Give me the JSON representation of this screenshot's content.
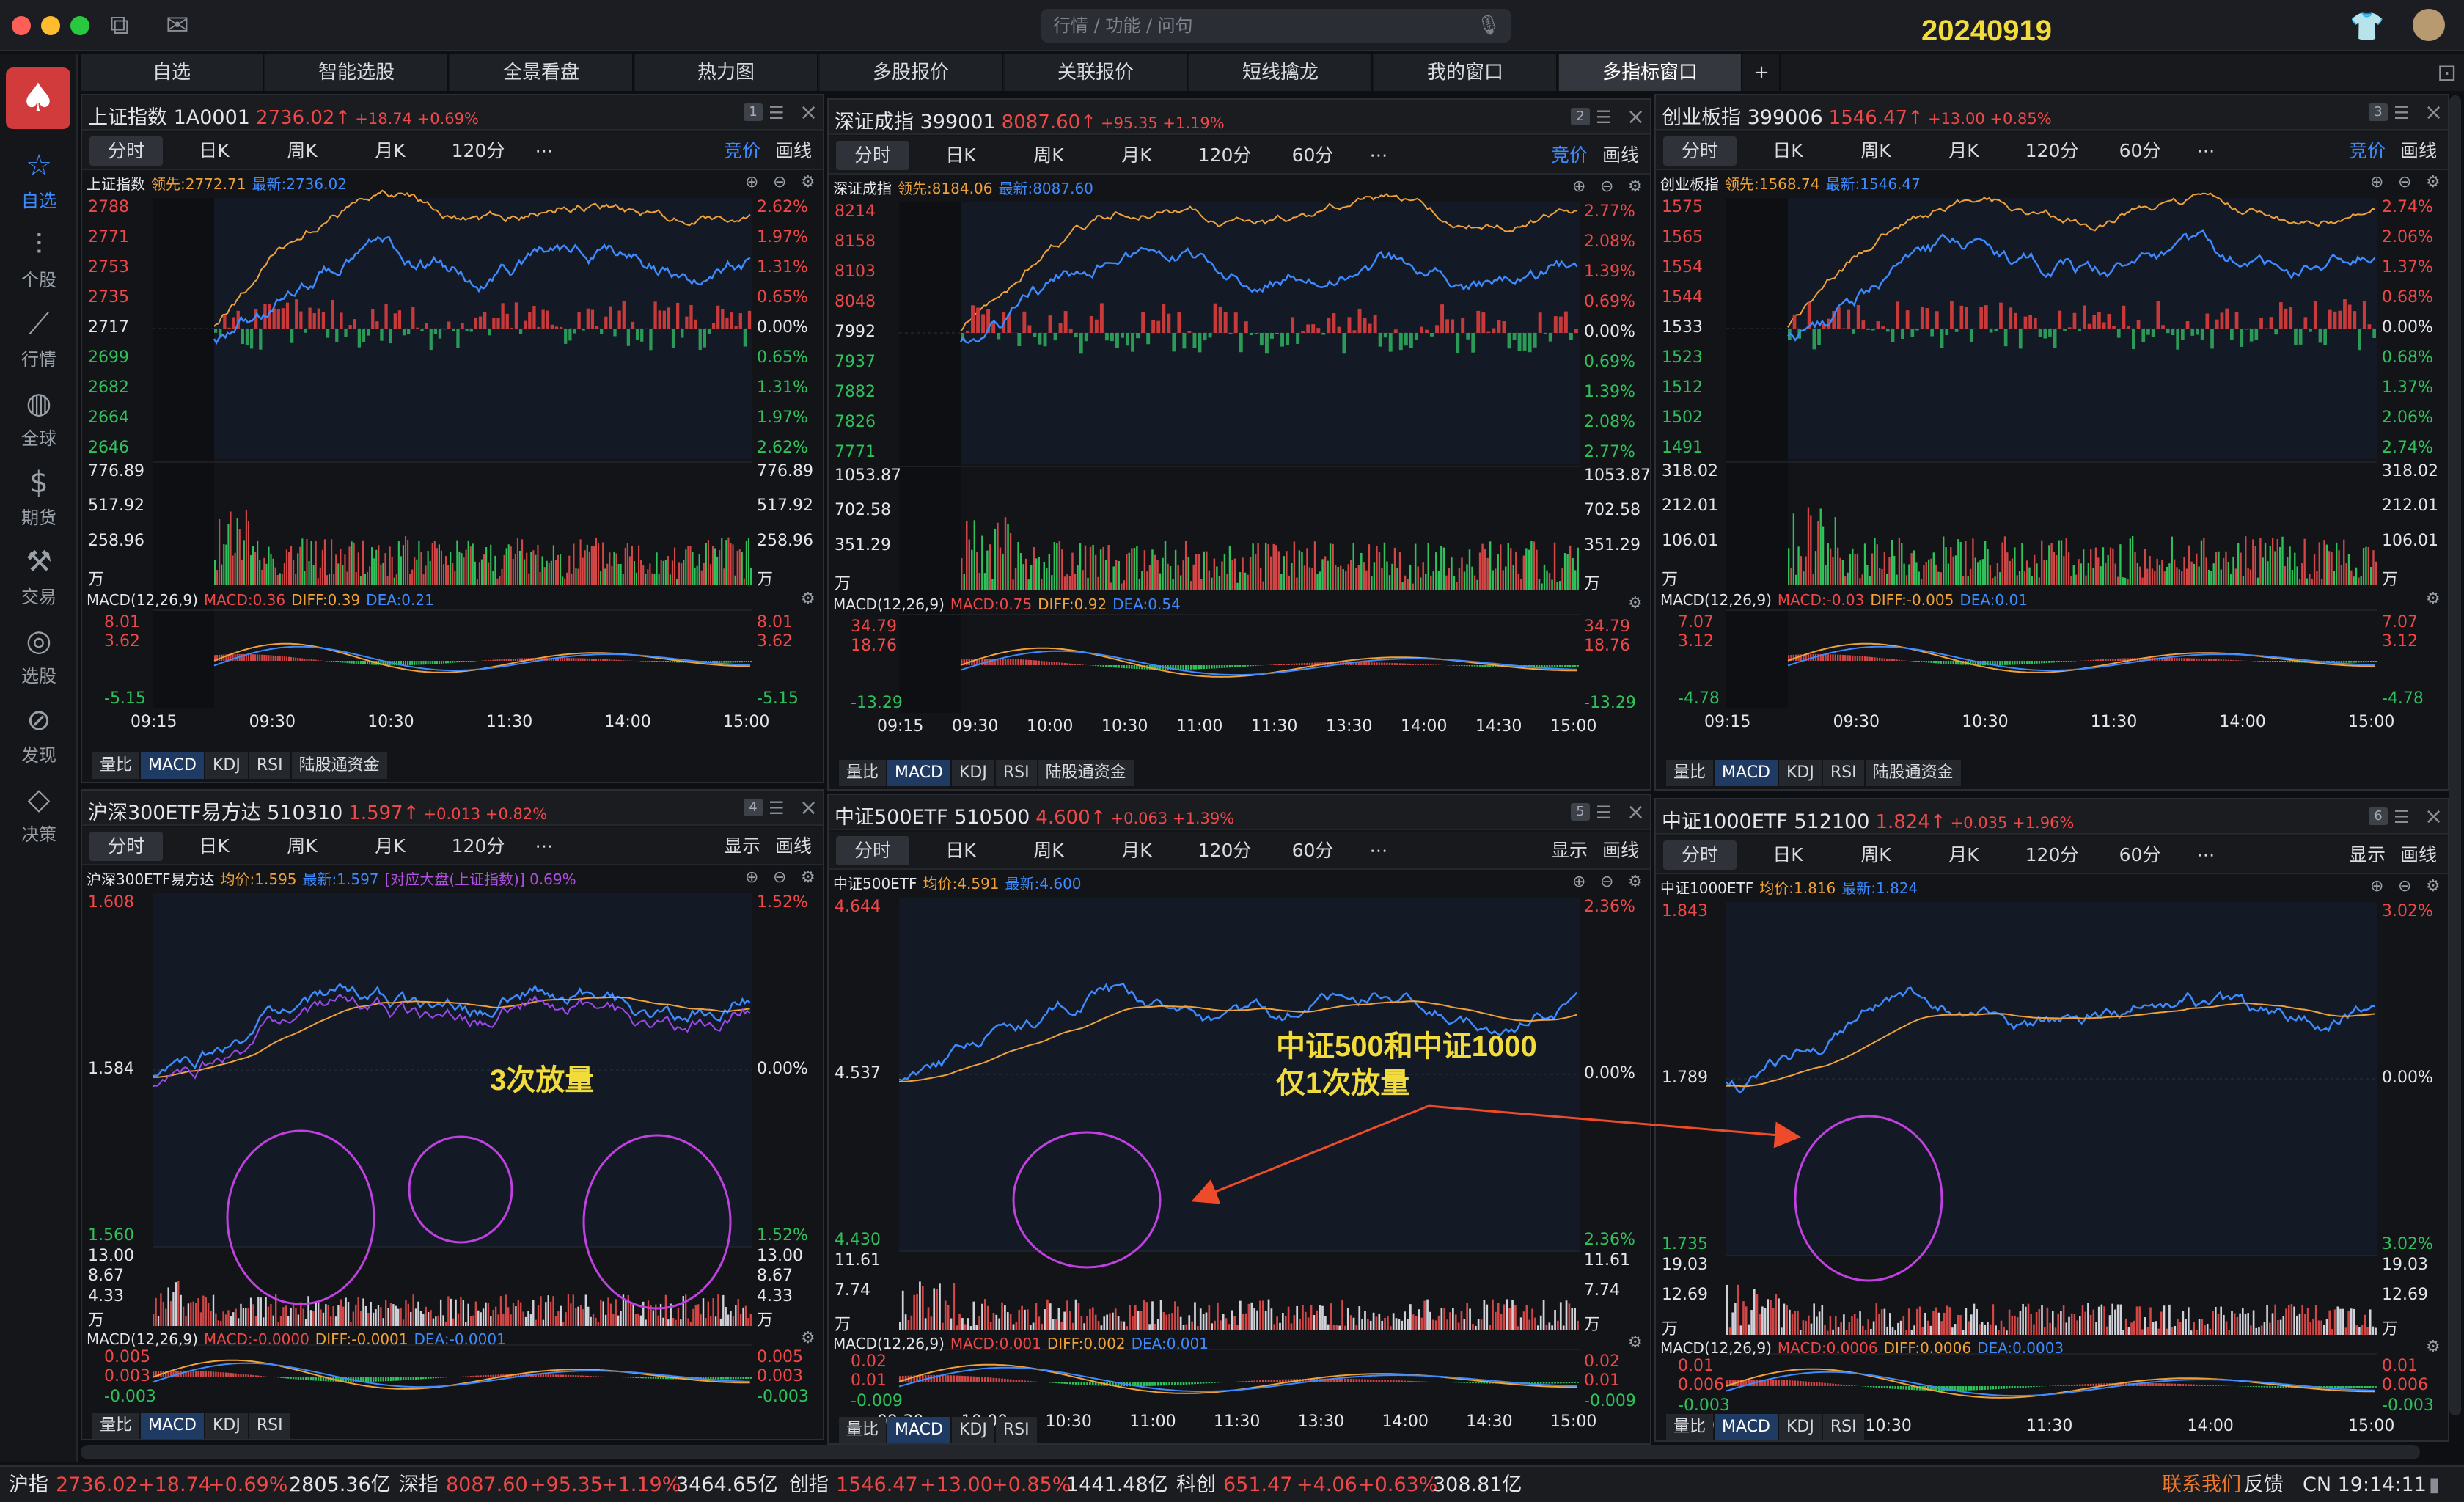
{
  "titlebar": {
    "search_placeholder": "行情 / 功能 / 问句",
    "date_tag": "20240919"
  },
  "tabs": [
    "自选",
    "智能选股",
    "全景看盘",
    "热力图",
    "多股报价",
    "关联报价",
    "短线擒龙",
    "我的窗口",
    "多指标窗口"
  ],
  "active_tab": 8,
  "sidebar": [
    {
      "label": "自选",
      "icon": "star-icon",
      "glyph": "☆"
    },
    {
      "label": "个股",
      "icon": "candlestick-icon",
      "glyph": "⫶"
    },
    {
      "label": "行情",
      "icon": "trend-icon",
      "glyph": "⟋"
    },
    {
      "label": "全球",
      "icon": "globe-icon",
      "glyph": "◍"
    },
    {
      "label": "期货",
      "icon": "futures-icon",
      "glyph": "$"
    },
    {
      "label": "交易",
      "icon": "hammer-icon",
      "glyph": "⚒"
    },
    {
      "label": "选股",
      "icon": "magnifier-icon",
      "glyph": "◎"
    },
    {
      "label": "发现",
      "icon": "compass-icon",
      "glyph": "⊘"
    },
    {
      "label": "决策",
      "icon": "diamond-icon",
      "glyph": "◇"
    }
  ],
  "top_tabs": [
    "分时",
    "日K",
    "周K",
    "月K",
    "120分",
    "60分"
  ],
  "panels": [
    {
      "idx": "1",
      "title": "上证指数 1A0001",
      "price": "2736.02↑",
      "chg": "+18.74 +0.69%",
      "tools": [
        "竞价",
        "画线"
      ],
      "info_name": "上证指数",
      "info_o": "领先:2772.71",
      "info_b": "最新:2736.02",
      "info_p": "",
      "price_left": [
        "2788",
        "2771",
        "2753",
        "2735",
        "2717",
        "2699",
        "2682",
        "2664",
        "2646"
      ],
      "price_right": [
        "2.62%",
        "1.97%",
        "1.31%",
        "0.65%",
        "0.00%",
        "0.65%",
        "1.31%",
        "1.97%",
        "2.62%"
      ],
      "vol_left": [
        "776.89",
        "517.92",
        "258.96",
        "万"
      ],
      "vol_right": [
        "776.89",
        "517.92",
        "258.96",
        "万"
      ],
      "macd_name": "MACD(12,26,9)",
      "macd_v": "MACD:0.36",
      "diff_v": "DIFF:0.39",
      "dea_v": "DEA:0.21",
      "macd_left": [
        "8.01",
        "3.62",
        "-5.15"
      ],
      "macd_right": [
        "8.01",
        "3.62",
        "-5.15"
      ],
      "times": [
        "09:15",
        "09:30",
        "10:30",
        "11:30",
        "14:00",
        "15:00"
      ],
      "btabs": [
        "量比",
        "MACD",
        "KDJ",
        "RSI",
        "陆股通资金"
      ]
    },
    {
      "idx": "2",
      "title": "深证成指 399001",
      "price": "8087.60↑",
      "chg": "+95.35 +1.19%",
      "tools": [
        "竞价",
        "画线"
      ],
      "info_name": "深证成指",
      "info_o": "领先:8184.06",
      "info_b": "最新:8087.60",
      "info_p": "",
      "price_left": [
        "8214",
        "8158",
        "8103",
        "8048",
        "7992",
        "7937",
        "7882",
        "7826",
        "7771"
      ],
      "price_right": [
        "2.77%",
        "2.08%",
        "1.39%",
        "0.69%",
        "0.00%",
        "0.69%",
        "1.39%",
        "2.08%",
        "2.77%"
      ],
      "vol_left": [
        "1053.87",
        "702.58",
        "351.29",
        "万"
      ],
      "vol_right": [
        "1053.87",
        "702.58",
        "351.29",
        "万"
      ],
      "macd_name": "MACD(12,26,9)",
      "macd_v": "MACD:0.75",
      "diff_v": "DIFF:0.92",
      "dea_v": "DEA:0.54",
      "macd_left": [
        "34.79",
        "18.76",
        "-13.29"
      ],
      "macd_right": [
        "34.79",
        "18.76",
        "-13.29"
      ],
      "times": [
        "09:15",
        "09:30",
        "10:00",
        "10:30",
        "11:00",
        "11:30",
        "13:30",
        "14:00",
        "14:30",
        "15:00"
      ],
      "btabs": [
        "量比",
        "MACD",
        "KDJ",
        "RSI",
        "陆股通资金"
      ]
    },
    {
      "idx": "3",
      "title": "创业板指 399006",
      "price": "1546.47↑",
      "chg": "+13.00 +0.85%",
      "tools": [
        "竞价",
        "画线"
      ],
      "info_name": "创业板指",
      "info_o": "领先:1568.74",
      "info_b": "最新:1546.47",
      "info_p": "",
      "price_left": [
        "1575",
        "1565",
        "1554",
        "1544",
        "1533",
        "1523",
        "1512",
        "1502",
        "1491"
      ],
      "price_right": [
        "2.74%",
        "2.06%",
        "1.37%",
        "0.68%",
        "0.00%",
        "0.68%",
        "1.37%",
        "2.06%",
        "2.74%"
      ],
      "vol_left": [
        "318.02",
        "212.01",
        "106.01",
        "万"
      ],
      "vol_right": [
        "318.02",
        "212.01",
        "106.01",
        "万"
      ],
      "macd_name": "MACD(12,26,9)",
      "macd_v": "MACD:-0.03",
      "diff_v": "DIFF:-0.005",
      "dea_v": "DEA:0.01",
      "macd_left": [
        "7.07",
        "3.12",
        "-4.78"
      ],
      "macd_right": [
        "7.07",
        "3.12",
        "-4.78"
      ],
      "times": [
        "09:15",
        "09:30",
        "10:30",
        "11:30",
        "14:00",
        "15:00"
      ],
      "btabs": [
        "量比",
        "MACD",
        "KDJ",
        "RSI",
        "陆股通资金"
      ]
    },
    {
      "idx": "4",
      "title": "沪深300ETF易方达 510310",
      "price": "1.597↑",
      "chg": "+0.013 +0.82%",
      "tools": [
        "显示",
        "画线"
      ],
      "info_name": "沪深300ETF易方达",
      "info_o": "均价:1.595",
      "info_b": "最新:1.597",
      "info_p": "[对应大盘(上证指数)] 0.69%",
      "price_left": [
        "1.608",
        "1.584",
        "1.560"
      ],
      "price_right": [
        "1.52%",
        "0.00%",
        "1.52%"
      ],
      "vol_left": [
        "13.00",
        "8.67",
        "4.33",
        "万"
      ],
      "vol_right": [
        "13.00",
        "8.67",
        "4.33",
        "万"
      ],
      "macd_name": "MACD(12,26,9)",
      "macd_v": "MACD:-0.0000",
      "diff_v": "DIFF:-0.0001",
      "dea_v": "DEA:-0.0001",
      "macd_left": [
        "0.005",
        "0.003",
        "-0.003"
      ],
      "macd_right": [
        "0.005",
        "0.003",
        "-0.003"
      ],
      "times": [],
      "btabs": [
        "量比",
        "MACD",
        "KDJ",
        "RSI"
      ]
    },
    {
      "idx": "5",
      "title": "中证500ETF 510500",
      "price": "4.600↑",
      "chg": "+0.063 +1.39%",
      "tools": [
        "显示",
        "画线"
      ],
      "info_name": "中证500ETF",
      "info_o": "均价:4.591",
      "info_b": "最新:4.600",
      "info_p": "",
      "price_left": [
        "4.644",
        "4.537",
        "4.430"
      ],
      "price_right": [
        "2.36%",
        "0.00%",
        "2.36%"
      ],
      "vol_left": [
        "11.61",
        "7.74",
        "万"
      ],
      "vol_right": [
        "11.61",
        "7.74",
        "万"
      ],
      "macd_name": "MACD(12,26,9)",
      "macd_v": "MACD:0.001",
      "diff_v": "DIFF:0.002",
      "dea_v": "DEA:0.001",
      "macd_left": [
        "0.02",
        "0.01",
        "-0.009"
      ],
      "macd_right": [
        "0.02",
        "0.01",
        "-0.009"
      ],
      "times": [
        "09:30",
        "10:00",
        "10:30",
        "11:00",
        "11:30",
        "13:30",
        "14:00",
        "14:30",
        "15:00"
      ],
      "btabs": [
        "量比",
        "MACD",
        "KDJ",
        "RSI"
      ]
    },
    {
      "idx": "6",
      "title": "中证1000ETF 512100",
      "price": "1.824↑",
      "chg": "+0.035 +1.96%",
      "tools": [
        "显示",
        "画线"
      ],
      "info_name": "中证1000ETF",
      "info_o": "均价:1.816",
      "info_b": "最新:1.824",
      "info_p": "",
      "price_left": [
        "1.843",
        "1.789",
        "1.735"
      ],
      "price_right": [
        "3.02%",
        "0.00%",
        "3.02%"
      ],
      "vol_left": [
        "19.03",
        "12.69",
        "万"
      ],
      "vol_right": [
        "19.03",
        "12.69",
        "万"
      ],
      "macd_name": "MACD(12,26,9)",
      "macd_v": "MACD:0.0006",
      "diff_v": "DIFF:0.0006",
      "dea_v": "DEA:0.0003",
      "macd_left": [
        "0.01",
        "0.006",
        "-0.003"
      ],
      "macd_right": [
        "0.01",
        "0.006",
        "-0.003"
      ],
      "times": [
        "09:30",
        "10:30",
        "11:30",
        "14:00",
        "15:00"
      ],
      "btabs": [
        "量比",
        "MACD",
        "KDJ",
        "RSI"
      ]
    }
  ],
  "annotations": {
    "a1": "3次放量",
    "a2": "中证500和中证1000",
    "a3": "仅1次放量"
  },
  "status": {
    "sh_name": "沪指",
    "sh_price": "2736.02",
    "sh_chg": "+18.74",
    "sh_pct": "+0.69%",
    "sh_amt": "2805.36亿",
    "sz_name": "深指",
    "sz_price": "8087.60",
    "sz_chg": "+95.35",
    "sz_pct": "+1.19%",
    "sz_amt": "3464.65亿",
    "cy_name": "创指",
    "cy_price": "1546.47",
    "cy_chg": "+13.00",
    "cy_pct": "+0.85%",
    "cy_amt": "1441.48亿",
    "kc_name": "科创",
    "kc_price": "651.47",
    "kc_chg": "+4.06",
    "kc_pct": "+0.63%",
    "kc_amt": "308.81亿",
    "contact": "联系我们",
    "feedback": "反馈",
    "clock": "CN 19:14:11"
  },
  "colors": {
    "up": "#ef4848",
    "down": "#2fc25b",
    "price_line": "#3d8bff",
    "avg_line": "#f0a23a",
    "accent": "#3d8bff",
    "annotation": "#f2dc3c",
    "circle": "#c040e0"
  }
}
